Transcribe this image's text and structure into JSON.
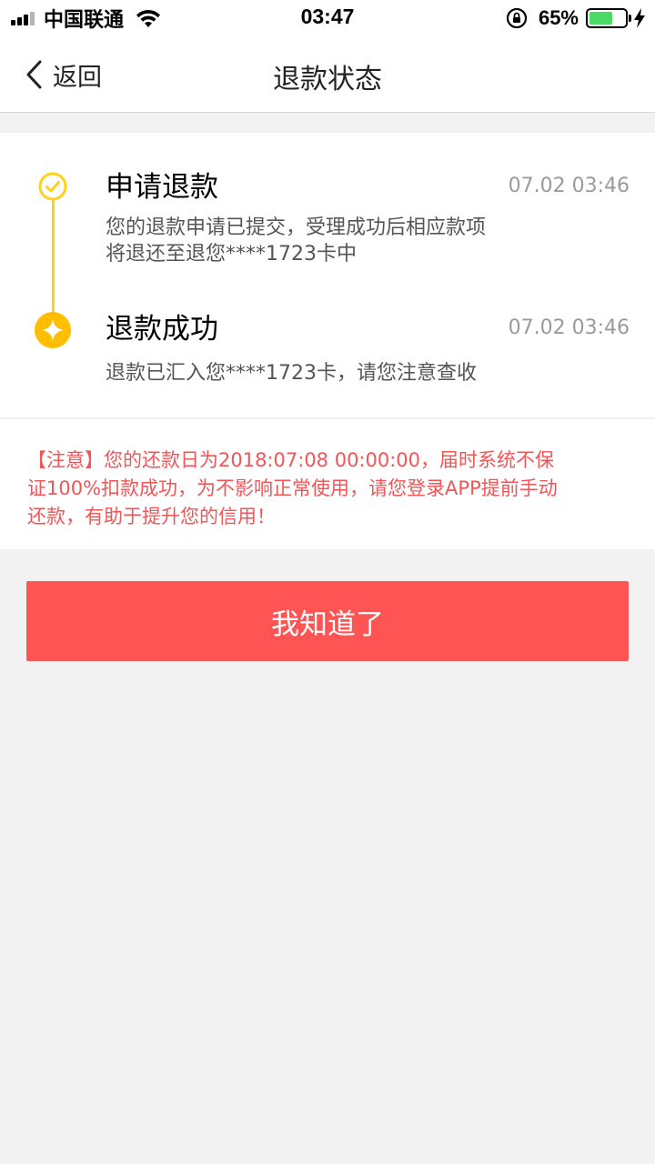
{
  "status_bar": {
    "carrier": "中国联通",
    "time": "03:47",
    "battery_percent_label": "65%",
    "battery_level": 0.65,
    "battery_color": "#4cd964",
    "icons": [
      "signal-icon",
      "wifi-icon",
      "orientation-lock-icon",
      "battery-icon",
      "charging-bolt-icon"
    ]
  },
  "nav": {
    "back_label": "返回",
    "title": "退款状态"
  },
  "timeline": {
    "accent_color": "#ffd21a",
    "steps": [
      {
        "title": "申请退款",
        "time": "07.02 03:46",
        "desc_line1": "您的退款申请已提交，受理成功后相应款项",
        "desc_line2": "将退还至退您****1723卡中",
        "icon": "check-circle-icon"
      },
      {
        "title": "退款成功",
        "time": "07.02 03:46",
        "desc_line1": "退款已汇入您****1723卡，请您注意查收",
        "icon": "sparkle-circle-icon"
      }
    ]
  },
  "notice": {
    "line1": "【注意】您的还款日为2018:07:08 00:00:00，届时系统不保",
    "line2": "证100%扣款成功，为不影响正常使用，请您登录APP提前手动",
    "line3": "还款，有助于提升您的信用！",
    "color": "#f25557"
  },
  "confirm_button": {
    "label": "我知道了",
    "color": "#fe5454"
  }
}
